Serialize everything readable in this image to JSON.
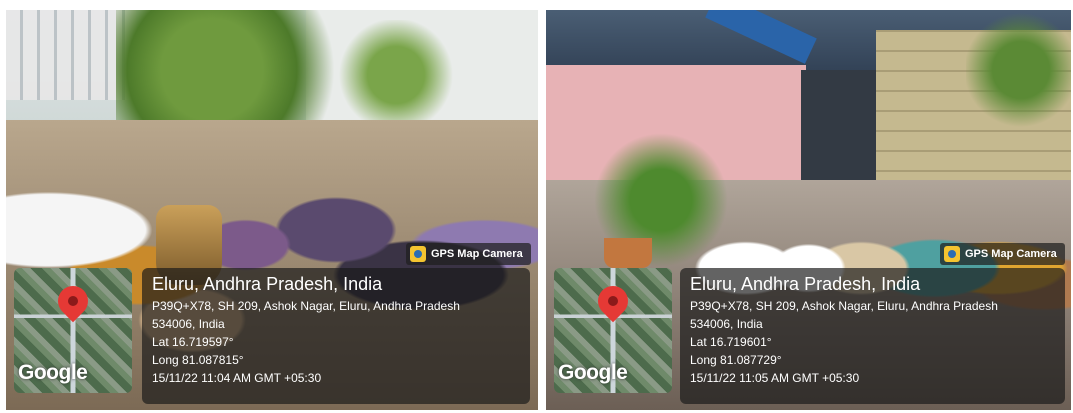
{
  "panels": [
    {
      "badge": "GPS Map Camera",
      "map_brand": "Google",
      "city": "Eluru, Andhra Pradesh, India",
      "address_line1": "P39Q+X78, SH 209, Ashok Nagar, Eluru, Andhra Pradesh",
      "address_line2": "534006, India",
      "lat": "Lat 16.719597°",
      "long": "Long 81.087815°",
      "datetime": "15/11/22 11:04 AM GMT +05:30"
    },
    {
      "badge": "GPS Map Camera",
      "map_brand": "Google",
      "city": "Eluru, Andhra Pradesh, India",
      "address_line1": "P39Q+X78, SH 209, Ashok Nagar, Eluru, Andhra Pradesh",
      "address_line2": "534006, India",
      "lat": "Lat 16.719601°",
      "long": "Long 81.087729°",
      "datetime": "15/11/22 11:05 AM GMT +05:30"
    }
  ],
  "colors": {
    "pin": "#e53935",
    "overlay": "#191919",
    "camera_icon": "#f4c430"
  },
  "icons": [
    "camera-icon",
    "map-pin-icon"
  ]
}
